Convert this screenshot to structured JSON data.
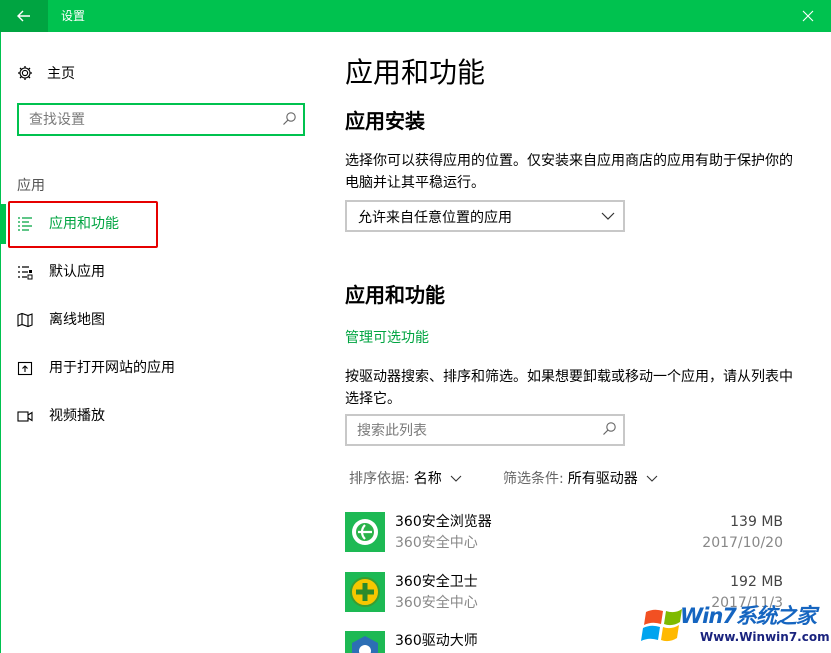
{
  "window": {
    "title": "设置"
  },
  "sidebar": {
    "home_label": "主页",
    "search_placeholder": "查找设置",
    "section_label": "应用",
    "items": [
      {
        "label": "应用和功能",
        "icon": "list-icon",
        "active": true
      },
      {
        "label": "默认应用",
        "icon": "default-apps-icon",
        "active": false
      },
      {
        "label": "离线地图",
        "icon": "map-icon",
        "active": false
      },
      {
        "label": "用于打开网站的应用",
        "icon": "open-in-icon",
        "active": false
      },
      {
        "label": "视频播放",
        "icon": "video-icon",
        "active": false
      }
    ]
  },
  "main": {
    "title": "应用和功能",
    "install": {
      "heading": "应用安装",
      "description": "选择你可以获得应用的位置。仅安装来自应用商店的应用有助于保护你的电脑并让其平稳运行。",
      "dropdown_value": "允许来自任意位置的应用"
    },
    "apps": {
      "heading": "应用和功能",
      "manage_link": "管理可选功能",
      "description": "按驱动器搜索、排序和筛选。如果想要卸载或移动一个应用，请从列表中选择它。",
      "search_placeholder": "搜索此列表",
      "sort_label": "排序依据:",
      "sort_value": "名称",
      "filter_label": "筛选条件:",
      "filter_value": "所有驱动器",
      "list": [
        {
          "name": "360安全浏览器",
          "publisher": "360安全中心",
          "size": "139 MB",
          "date": "2017/10/20"
        },
        {
          "name": "360安全卫士",
          "publisher": "360安全中心",
          "size": "192 MB",
          "date": "2017/11/3"
        },
        {
          "name": "360驱动大师",
          "publisher": "",
          "size": "",
          "date": ""
        }
      ]
    }
  },
  "watermark": {
    "brand": "Win7系统之家",
    "url": "Www.Winwin7.com"
  },
  "colors": {
    "accent": "#00c24f",
    "accent_dark": "#00a441",
    "highlight_box": "#e60000"
  }
}
